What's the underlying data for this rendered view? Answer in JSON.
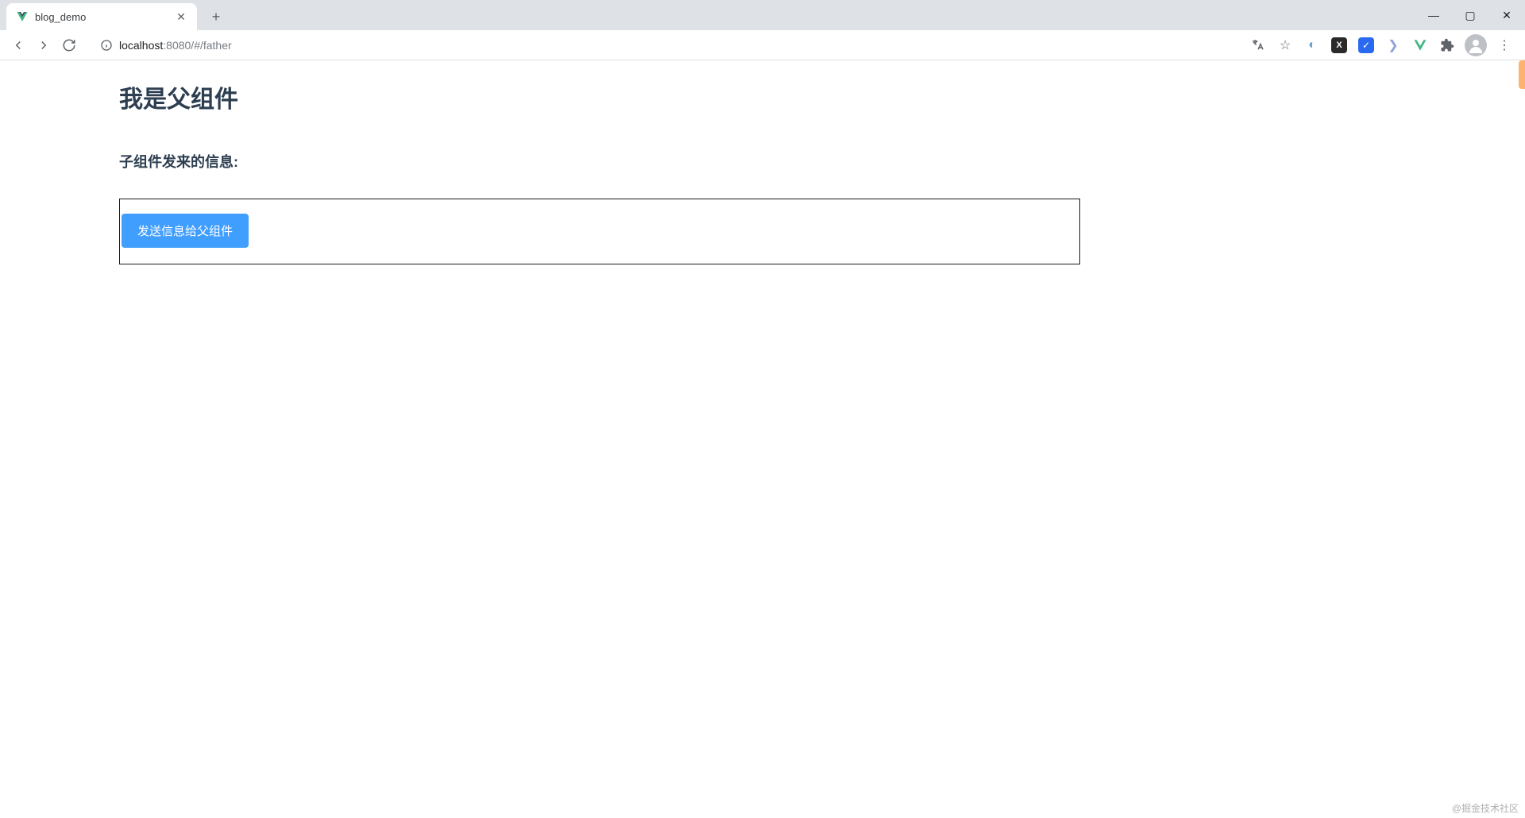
{
  "browser": {
    "tab_title": "blog_demo",
    "url_host": "localhost",
    "url_port_path": ":8080/#/father",
    "window_controls": {
      "min": "—",
      "max": "▢",
      "close": "✕"
    }
  },
  "page": {
    "heading": "我是父组件",
    "message_label": "子组件发来的信息:",
    "send_button_label": "发送信息给父组件"
  },
  "watermark": "@掘金技术社区"
}
